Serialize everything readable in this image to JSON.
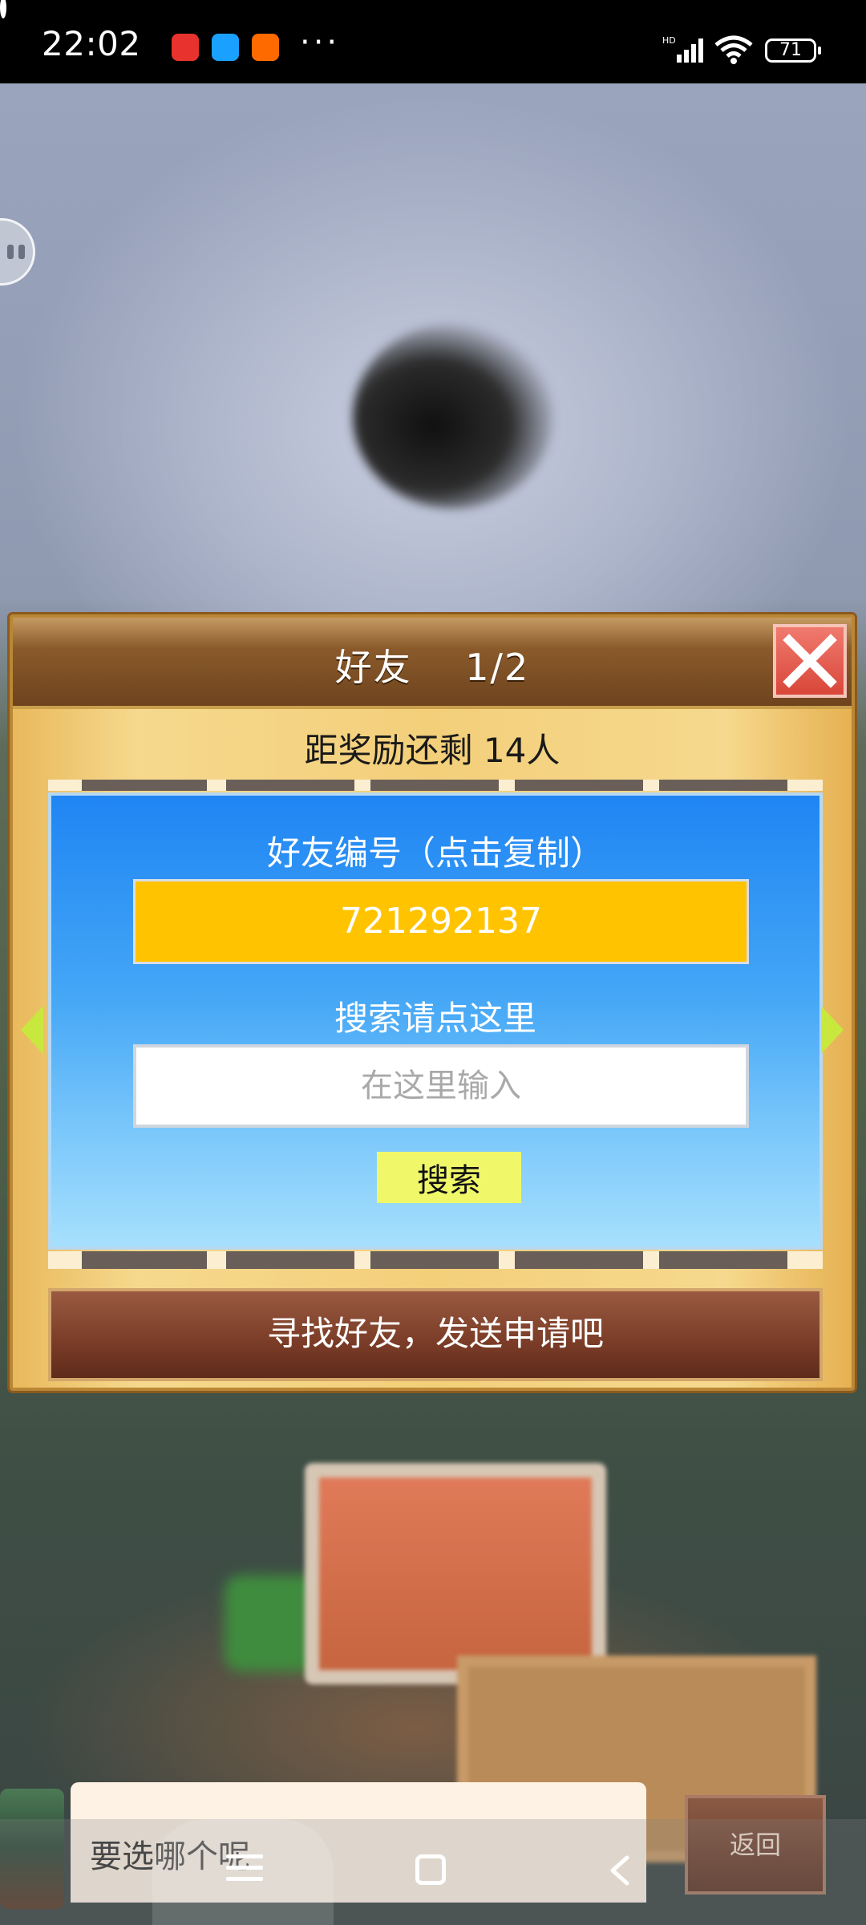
{
  "status_bar": {
    "time": "22:02",
    "more": "···",
    "battery": "71",
    "network": "HD"
  },
  "dialog": {
    "title": "好友    1/2",
    "close_icon": "close-x",
    "reward_text": "距奖励还剩 14人",
    "friend_code_label": "好友编号（点击复制）",
    "friend_code": "721292137",
    "search_label": "搜索请点这里",
    "search_placeholder": "在这里输入",
    "search_value": "",
    "search_button": "搜索",
    "find_friends_button": "寻找好友，发送申请吧"
  },
  "bottom": {
    "prompt_text": "要选哪个呢",
    "back_button": "返回"
  },
  "colors": {
    "accent_blue": "#1f85f3",
    "code_yellow": "#ffc300",
    "close_red": "#d84739",
    "search_btn": "#f0f86a",
    "wood": "#f3cf7a"
  }
}
